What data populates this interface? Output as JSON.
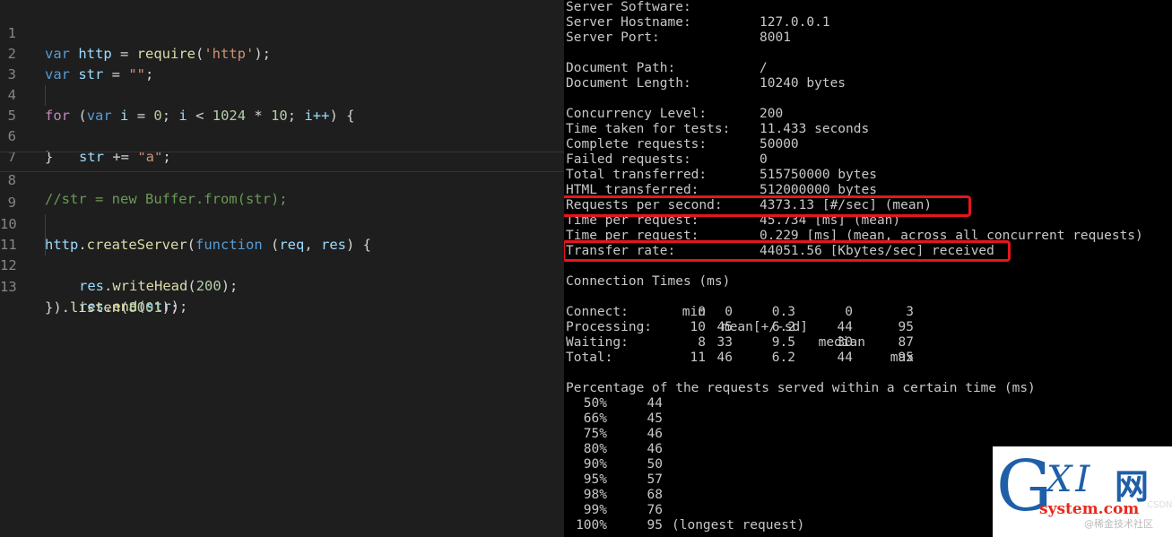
{
  "editor": {
    "lines": [
      {
        "no": "1"
      },
      {
        "no": "2"
      },
      {
        "no": "3"
      },
      {
        "no": "4"
      },
      {
        "no": "5"
      },
      {
        "no": "6"
      },
      {
        "no": "7"
      },
      {
        "no": "8"
      },
      {
        "no": "9"
      },
      {
        "no": "10"
      },
      {
        "no": "11"
      },
      {
        "no": "12"
      },
      {
        "no": "13"
      }
    ],
    "tokens": {
      "var": "var",
      "http": "http",
      "eq": " = ",
      "require": "require",
      "http_str": "'http'",
      "end_paren_semi": ");",
      "open_paren": "(",
      "str": "str",
      "empty_str": "\"\"",
      "semi": ";",
      "for": "for",
      "i": "i",
      "zero": "0",
      "lt": " < ",
      "n1024": "1024",
      "times": " * ",
      "ten": "10",
      "incr": "i++",
      "close_brace_open": ") {",
      "plus_eq": " += ",
      "a_str": "\"a\"",
      "close_brace": "}",
      "comment": "//str = new Buffer.from(str);",
      "create_server": "createServer",
      "dot": ".",
      "function": "function",
      "req": "req",
      "comma": ", ",
      "res": "res",
      "write_head": "writeHead",
      "n200": "200",
      "end": "end",
      "listen": "listen",
      "n8001": "8001",
      "close_listen_prefix": "})."
    }
  },
  "terminal": {
    "info": [
      {
        "label": "Server Software:",
        "value": ""
      },
      {
        "label": "Server Hostname:",
        "value": "127.0.0.1"
      },
      {
        "label": "Server Port:",
        "value": "8001"
      },
      {
        "label": "",
        "value": ""
      },
      {
        "label": "Document Path:",
        "value": "/"
      },
      {
        "label": "Document Length:",
        "value": "10240 bytes"
      },
      {
        "label": "",
        "value": ""
      },
      {
        "label": "Concurrency Level:",
        "value": "200"
      },
      {
        "label": "Time taken for tests:",
        "value": "11.433 seconds"
      },
      {
        "label": "Complete requests:",
        "value": "50000"
      },
      {
        "label": "Failed requests:",
        "value": "0"
      },
      {
        "label": "Total transferred:",
        "value": "515750000 bytes"
      },
      {
        "label": "HTML transferred:",
        "value": "512000000 bytes"
      },
      {
        "label": "Requests per second:",
        "value": "4373.13 [#/sec] (mean)"
      },
      {
        "label": "Time per request:",
        "value": "45.734 [ms] (mean)"
      },
      {
        "label": "Time per request:",
        "value": "0.229 [ms] (mean, across all concurrent requests)"
      },
      {
        "label": "Transfer rate:",
        "value": "44051.56 [Kbytes/sec] received"
      }
    ],
    "connection_title": "Connection Times (ms)",
    "connection_headers": [
      "min",
      "mean[+/-sd]",
      "median",
      "max"
    ],
    "connection_rows": [
      {
        "label": "Connect:",
        "min": "0",
        "mean": "0",
        "sd": "0.3",
        "median": "0",
        "max": "3"
      },
      {
        "label": "Processing:",
        "min": "10",
        "mean": "45",
        "sd": "6.2",
        "median": "44",
        "max": "95"
      },
      {
        "label": "Waiting:",
        "min": "8",
        "mean": "33",
        "sd": "9.5",
        "median": "30",
        "max": "87"
      },
      {
        "label": "Total:",
        "min": "11",
        "mean": "46",
        "sd": "6.2",
        "median": "44",
        "max": "95"
      }
    ],
    "percentage_title": "Percentage of the requests served within a certain time (ms)",
    "percentiles": [
      {
        "pct": "50%",
        "ms": "44",
        "note": ""
      },
      {
        "pct": "66%",
        "ms": "45",
        "note": ""
      },
      {
        "pct": "75%",
        "ms": "46",
        "note": ""
      },
      {
        "pct": "80%",
        "ms": "46",
        "note": ""
      },
      {
        "pct": "90%",
        "ms": "50",
        "note": ""
      },
      {
        "pct": "95%",
        "ms": "57",
        "note": ""
      },
      {
        "pct": "98%",
        "ms": "68",
        "note": ""
      },
      {
        "pct": "99%",
        "ms": "76",
        "note": ""
      },
      {
        "pct": "100%",
        "ms": "95",
        "note": "(longest request)"
      }
    ],
    "highlight_color": "#e5161c"
  },
  "watermark": {
    "g": "G",
    "xi": "XI",
    "cn": "网",
    "site": "system.com",
    "small": "@稀金技术社区",
    "faint": "CSDN"
  }
}
